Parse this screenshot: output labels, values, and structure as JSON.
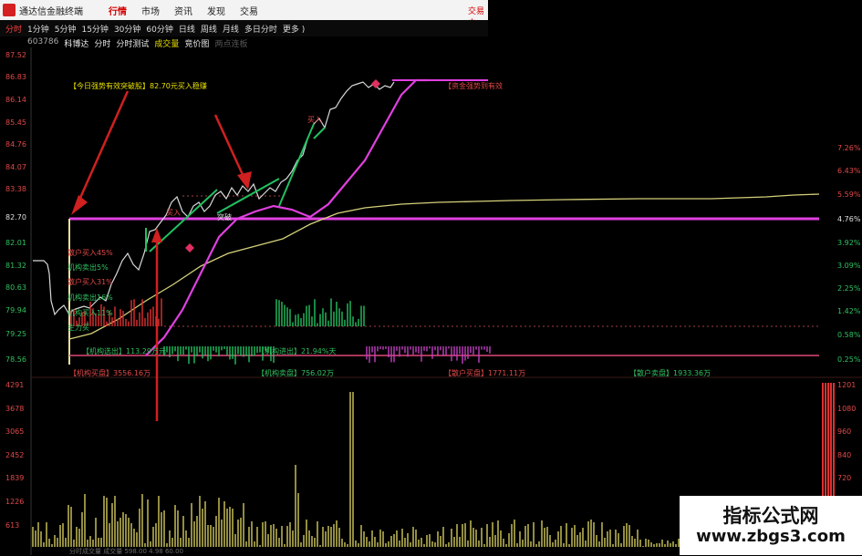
{
  "topbar": {
    "app_title": "通达信金融终端",
    "menu": [
      "行情",
      "市场",
      "资讯",
      "发现",
      "交易"
    ],
    "active_menu": 0,
    "right_text": "交易中"
  },
  "periods": {
    "items": [
      "分时",
      "1分钟",
      "5分钟",
      "15分钟",
      "30分钟",
      "60分钟",
      "日线",
      "周线",
      "月线",
      "多日分时",
      "更多 )"
    ],
    "active": 0
  },
  "info": {
    "code": "603786",
    "name": "科博达",
    "tabs": [
      "分时",
      "分时测试",
      "成交量",
      "竞价图",
      "两点连板"
    ]
  },
  "price_axis": [
    "87.52",
    "86.83",
    "86.14",
    "85.45",
    "84.76",
    "84.07",
    "83.38",
    "82.70",
    "82.01",
    "81.32",
    "80.63",
    "79.94",
    "79.25",
    "78.56"
  ],
  "pct_axis": [
    "7.26%",
    "6.43%",
    "5.59%",
    "4.76%",
    "3.92%",
    "3.09%",
    "2.25%",
    "1.42%",
    "0.58%",
    "0.25%"
  ],
  "vol_axis": [
    "4291",
    "3678",
    "3065",
    "2452",
    "1839",
    "1226",
    "613"
  ],
  "vol_right": [
    "1201",
    "1080",
    "960",
    "840",
    "720",
    "600"
  ],
  "annotations": {
    "signal": "【今日强势有效突破股】82.70元买入稳赚",
    "top_right": "【资金强势到有效",
    "left_labels": [
      "散户买入45%",
      "机构卖出5%",
      "散户买入31%",
      "机构卖出16%",
      "机构买入11%",
      "主力买"
    ],
    "breakthrough": "突破",
    "buy1": "买入",
    "buy2": "买入",
    "bottom_a": "【机构选出】113.29万元",
    "bottom_b": "【机构进出】21.94%天",
    "inst_buy": "【机构买盘】3556.16万",
    "inst_sell": "【机构卖盘】756.02万",
    "retail_buy": "【散户买盘】1771.11万",
    "retail_sell": "【散户卖盘】1933.36万",
    "bottom_status": "分时成交量  成交量  598.00  4.98  60.00"
  },
  "watermark": {
    "title": "指标公式网",
    "url": "www.zbgs3.com"
  },
  "colors": {
    "price_line": "#d8d8d8",
    "avg_line": "#d4d07a",
    "magenta": "#e040e0",
    "up_red": "#e03030",
    "down_green": "#22c060",
    "volume_yellow": "#b8b050"
  },
  "icons": [
    "logo-icon",
    "diamond-icon"
  ]
}
